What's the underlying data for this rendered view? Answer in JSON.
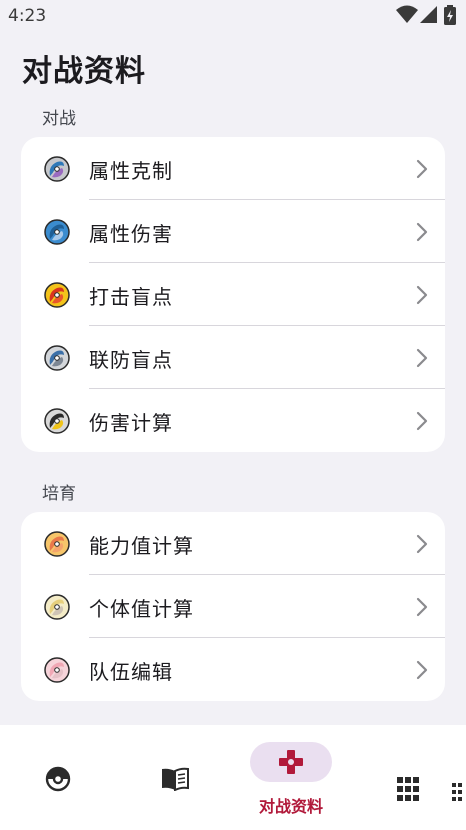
{
  "status": {
    "time": "4:23"
  },
  "page": {
    "title": "对战资料"
  },
  "sections": [
    {
      "label": "对战",
      "items": [
        {
          "label": "属性克制",
          "icon": "pokeball-grey-blue-icon"
        },
        {
          "label": "属性伤害",
          "icon": "pokeball-blue-icon"
        },
        {
          "label": "打击盲点",
          "icon": "pokeball-red-yellow-icon"
        },
        {
          "label": "联防盲点",
          "icon": "pokeball-blue-grey-icon"
        },
        {
          "label": "伤害计算",
          "icon": "pokeball-dark-yellow-icon"
        }
      ]
    },
    {
      "label": "培育",
      "items": [
        {
          "label": "能力值计算",
          "icon": "pokeball-orange-icon"
        },
        {
          "label": "个体值计算",
          "icon": "pokeball-cream-icon"
        },
        {
          "label": "队伍编辑",
          "icon": "pokeball-pink-icon"
        }
      ]
    }
  ],
  "bottom_nav": {
    "active_label": "对战资料",
    "accent": "#b1193a",
    "pill_color": "#eadff0"
  }
}
